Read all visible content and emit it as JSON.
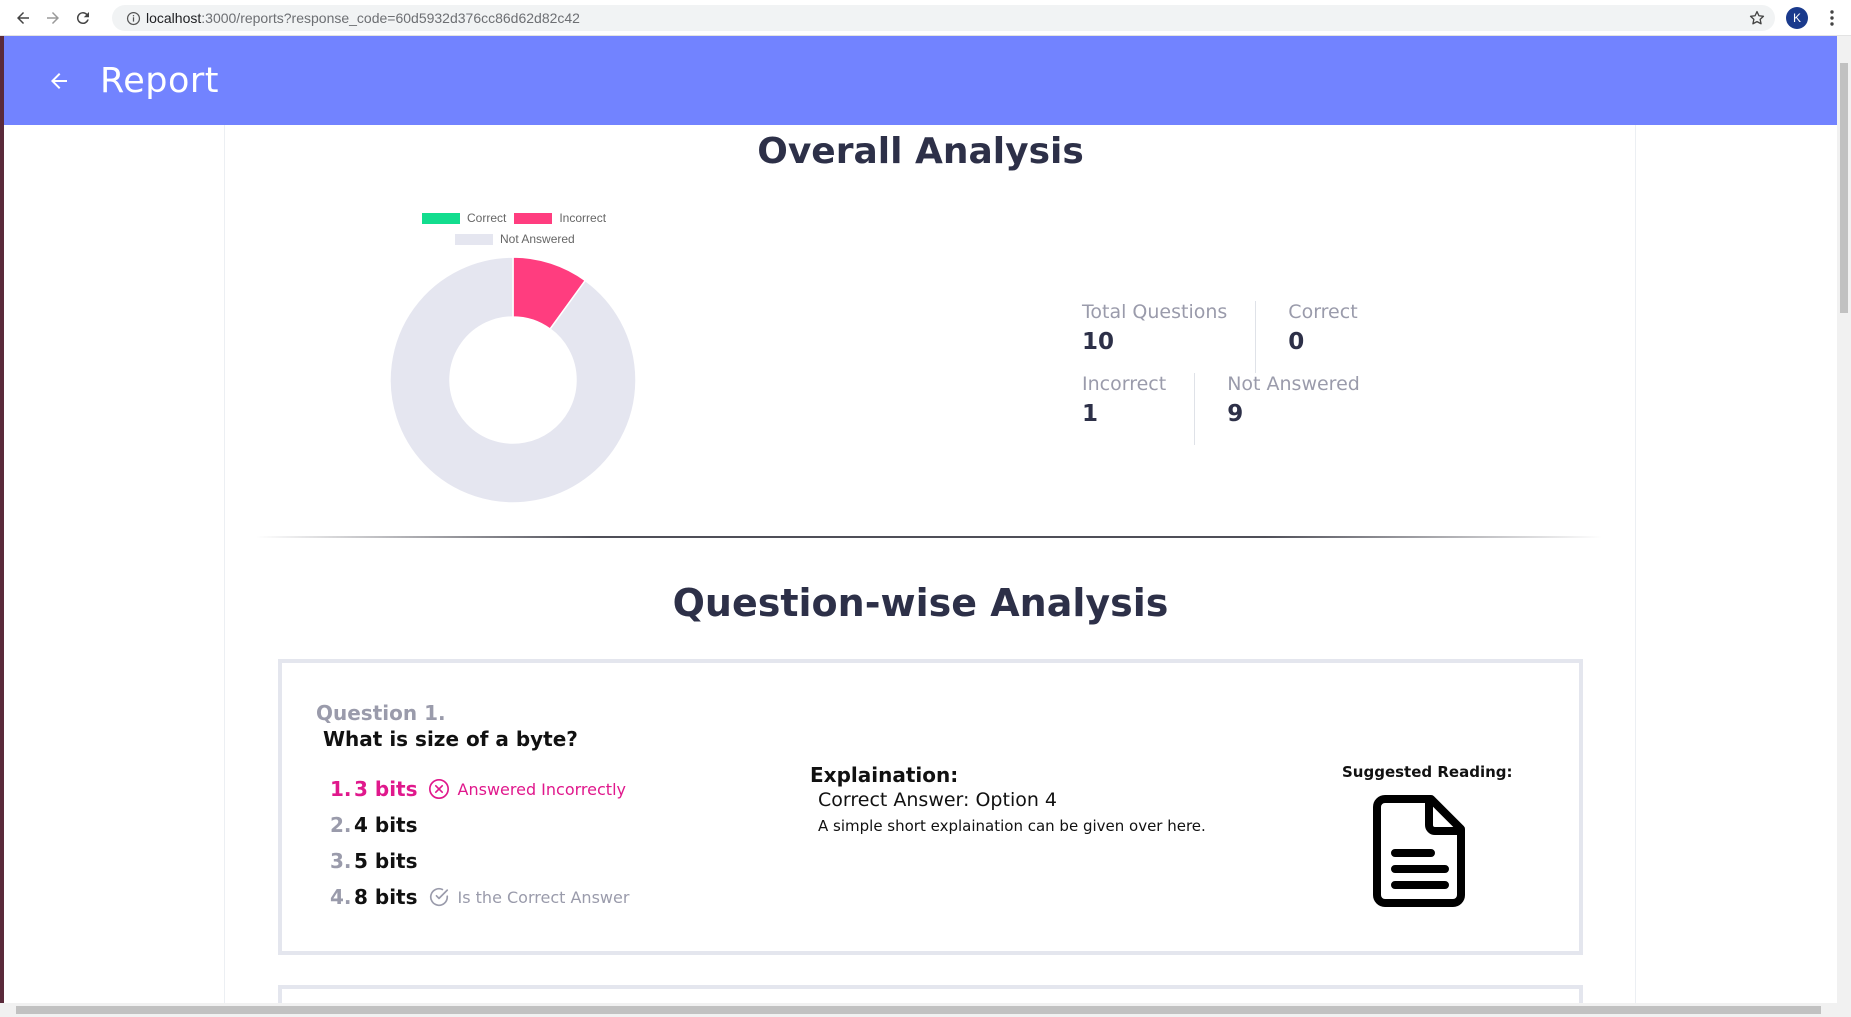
{
  "browser": {
    "url_host": "localhost",
    "url_rest": ":3000/reports?response_code=60d5932d376cc86d62d82c42",
    "avatar_initial": "K"
  },
  "appbar": {
    "title": "Report",
    "color": "#7283ff"
  },
  "overall": {
    "title": "Overall Analysis",
    "legend": [
      {
        "label": "Correct",
        "color": "#12dd8e"
      },
      {
        "label": "Incorrect",
        "color": "#ff3d7f"
      },
      {
        "label": "Not Answered",
        "color": "#e5e6f0"
      }
    ],
    "stats": {
      "total_label": "Total Questions",
      "total_value": "10",
      "correct_label": "Correct",
      "correct_value": "0",
      "incorrect_label": "Incorrect",
      "incorrect_value": "1",
      "not_answered_label": "Not Answered",
      "not_answered_value": "9"
    }
  },
  "chart_data": {
    "type": "pie",
    "categories": [
      "Correct",
      "Incorrect",
      "Not Answered"
    ],
    "values": [
      0,
      1,
      9
    ],
    "colors": [
      "#12dd8e",
      "#ff3d7f",
      "#e5e6f0"
    ],
    "legend_position": "top"
  },
  "question_wise": {
    "title": "Question-wise Analysis",
    "questions": [
      {
        "number_label": "Question 1.",
        "text": "What is size of a byte?",
        "options": [
          {
            "num": "1.",
            "text": "3 bits",
            "status": "Answered Incorrectly"
          },
          {
            "num": "2.",
            "text": "4 bits"
          },
          {
            "num": "3.",
            "text": "5 bits"
          },
          {
            "num": "4.",
            "text": "8 bits",
            "status": "Is the Correct Answer"
          }
        ],
        "explanation_title": "Explaination:",
        "correct_answer": "Correct Answer: Option 4",
        "explanation_text": "A simple short explaination can be given over here.",
        "suggested_reading_title": "Suggested Reading:"
      }
    ]
  }
}
